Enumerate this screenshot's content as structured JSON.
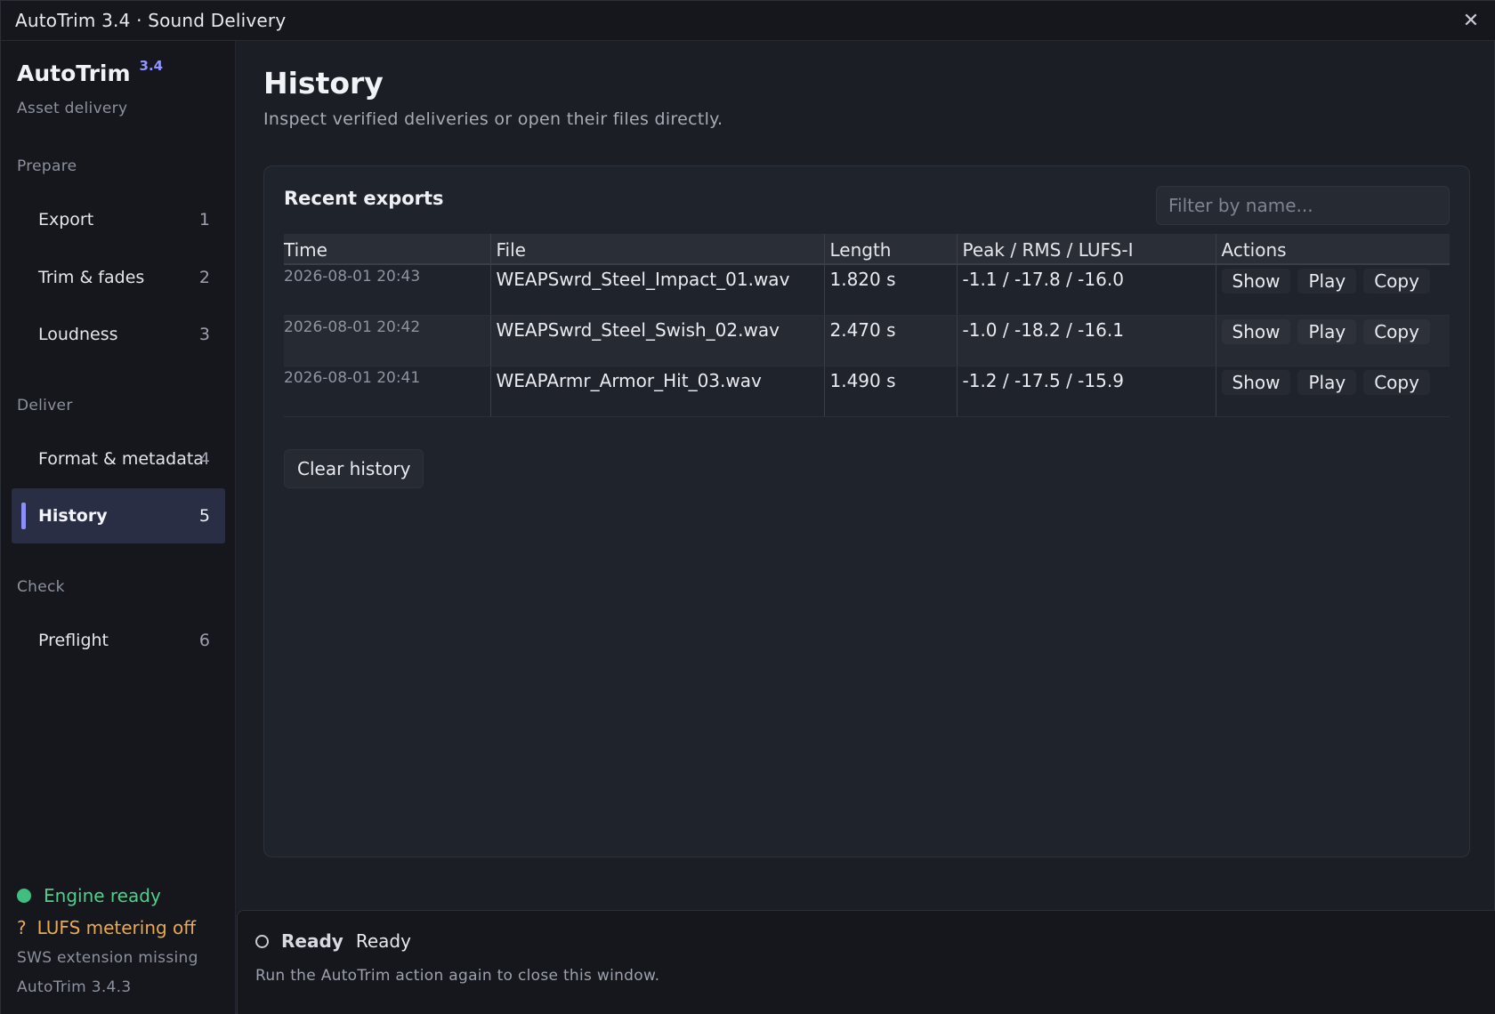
{
  "window": {
    "title": "AutoTrim 3.4  ·  Sound Delivery",
    "close_glyph": "✕"
  },
  "sidebar": {
    "brand_name": "AutoTrim",
    "brand_version": "3.4",
    "brand_sub": "Asset delivery",
    "sections": {
      "prepare": "Prepare",
      "deliver": "Deliver",
      "check": "Check"
    },
    "items": [
      {
        "label": "Export",
        "num": "1"
      },
      {
        "label": "Trim & fades",
        "num": "2"
      },
      {
        "label": "Loudness",
        "num": "3"
      },
      {
        "label": "Format & metadata",
        "num": "4"
      },
      {
        "label": "History",
        "num": "5"
      },
      {
        "label": "Preflight",
        "num": "6"
      }
    ],
    "active_item": "History",
    "status": {
      "engine": "Engine ready",
      "lufs_glyph": "?",
      "lufs": "LUFS metering off",
      "sws": "SWS extension missing",
      "version": "AutoTrim 3.4.3"
    },
    "accent_color": "#8b8ff7"
  },
  "main": {
    "title": "History",
    "subtitle": "Inspect verified deliveries or open their files directly.",
    "card": {
      "title": "Recent exports",
      "filter_placeholder": "Filter by name...",
      "columns": [
        "Time",
        "File",
        "Length",
        "Peak / RMS / LUFS-I",
        "Actions"
      ],
      "rows": [
        {
          "time": "2026-08-01 20:43",
          "file": "WEAPSwrd_Steel_Impact_01.wav",
          "length": "1.820 s",
          "levels": "-1.1 / -17.8 / -16.0"
        },
        {
          "time": "2026-08-01 20:42",
          "file": "WEAPSwrd_Steel_Swish_02.wav",
          "length": "2.470 s",
          "levels": "-1.0 / -18.2 / -16.1"
        },
        {
          "time": "2026-08-01 20:41",
          "file": "WEAPArmr_Armor_Hit_03.wav",
          "length": "1.490 s",
          "levels": "-1.2 / -17.5 / -15.9"
        }
      ],
      "actions": [
        "Show",
        "Play",
        "Copy"
      ],
      "clear_label": "Clear history"
    }
  },
  "statusbar": {
    "label": "Ready",
    "text": "Ready",
    "hint": "Run the AutoTrim action again to close this window."
  }
}
